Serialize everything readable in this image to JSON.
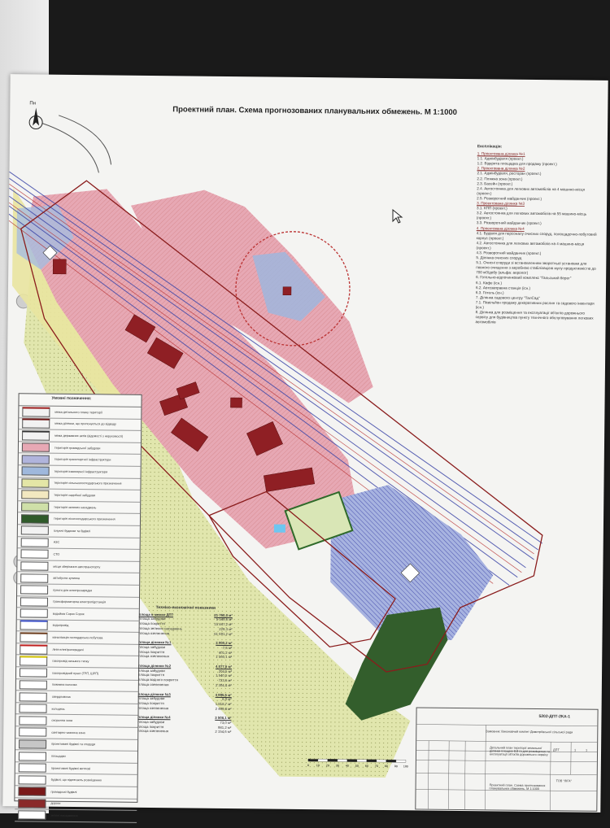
{
  "title": "Проектний план. Схема прогнозованих планувальних обмежень. М 1:1000",
  "north_label": "Пн",
  "explication": {
    "header": "Експлікація:",
    "items": [
      {
        "text": "1. Проектована ділянка №1",
        "section": true
      },
      {
        "text": "1.1. Адмінбудівля (проект.)"
      },
      {
        "text": "1.2. Відкрита площадка для продажу (проект.)"
      },
      {
        "text": "2. Проектована ділянка №2",
        "section": true
      },
      {
        "text": "2.1. Адмінбудівля, ресторан (проект.)"
      },
      {
        "text": "2.2. Пляжна зона (проект.)"
      },
      {
        "text": "2.3. Басейн (проект.)"
      },
      {
        "text": "2.4. Автостоянка для легкових автомобілів на 4 машино-місця (проект.)"
      },
      {
        "text": "2.5. Розворотний майданчик (проект.)"
      },
      {
        "text": "3. Проектована ділянка №3",
        "section": true
      },
      {
        "text": "3.1. КПП (проект.)"
      },
      {
        "text": "3.2. Автостоянка для легкових автомобілів на 55 машино-місць (проект.)"
      },
      {
        "text": "3.3. Розворотний майданчик (проект.)"
      },
      {
        "text": "4. Проектована ділянка №4",
        "section": true
      },
      {
        "text": "4.1. Будівля для персоналу очисних споруд, полощадочно-побутовий корпус (проект.)"
      },
      {
        "text": "4.2. Автостоянка для легкових автомобілів на 4 машино-місця (проект.)"
      },
      {
        "text": "4.3. Розворотний майданчик (проект.)"
      },
      {
        "text": "5. Ділянка очисних споруд"
      },
      {
        "text": "5.1. Очисні споруди зі встановленням зворотньої установки для повного очищення з аеробною стабілізацією мулу продуктивністю до 700 м3/добу (альфа: аеропот)"
      },
      {
        "text": "6. Готельно-відпочинковий комплекс \"Гальський берег\""
      },
      {
        "text": "6.1. Кафе (існ.)"
      },
      {
        "text": "6.2. Автозаправна станція (існ.)"
      },
      {
        "text": "6.3. Готель (існ.)"
      },
      {
        "text": "7. Ділянка садового центру \"ТалСад\""
      },
      {
        "text": "7.1. Павільйон продажу декоративних рослин та садового інвентаря (існ.)"
      },
      {
        "text": "8. Ділянка для розміщення та експлуатації об'єктів дорожнього сервісу для будівництва пункту технічного обслуговування легкових автомобілів"
      }
    ]
  },
  "legend": {
    "header": "Умовні позначення:",
    "rows": [
      {
        "label": "межа детального плану території",
        "swatch": "#f2f2f2",
        "line": "#9b1c1c"
      },
      {
        "label": "межа ділянки, що пропонується до відводу",
        "swatch": "#f2f2f2",
        "line": "#6b1414"
      },
      {
        "label": "межа державних актів (відомості з нерухомості)",
        "swatch": "#f2f2f2",
        "line": "#333333"
      },
      {
        "label": "територія громадської забудови",
        "swatch": "#e7a8b4"
      },
      {
        "label": "територія транспортної інфраструктури",
        "swatch": "#b0b4dc"
      },
      {
        "label": "територія інженерної інфраструктури",
        "swatch": "#9fb8dc"
      },
      {
        "label": "територія сільськогосподарського призначення",
        "swatch": "#e4e6a6"
      },
      {
        "label": "територія садибної забудови",
        "swatch": "#f2e8c0"
      },
      {
        "label": "територія зелених насаджень",
        "swatch": "#cfe0a8"
      },
      {
        "label": "територія лісогосподарського призначення",
        "swatch": "#2f5a2a"
      },
      {
        "label": "існуючі будинки та будівлі",
        "swatch": "#f2f2f2"
      },
      {
        "label": "АЗС",
        "swatch": "#ffffff"
      },
      {
        "label": "СТО",
        "swatch": "#ffffff"
      },
      {
        "label": "місця зберігання автотранспорту",
        "swatch": "#ffffff"
      },
      {
        "label": "автобусна зупинка",
        "swatch": "#ffffff"
      },
      {
        "label": "пункти для електрозарядки",
        "swatch": "#ffffff"
      },
      {
        "label": "трансформаторна електропідстанція",
        "swatch": "#ffffff"
      },
      {
        "label": "водойма Сорок Сорок",
        "swatch": "#ffffff"
      },
      {
        "label": "водопровід",
        "swatch": "#ffffff",
        "line": "#3a4ec8"
      },
      {
        "label": "каналізація господарсько-побутова",
        "swatch": "#ffffff",
        "line": "#6a3a1a"
      },
      {
        "label": "лінія електропередачі",
        "swatch": "#ffffff",
        "line": "#c02020"
      },
      {
        "label": "газопровід низького тиску",
        "swatch": "#ffffff",
        "line": "#d0c000"
      },
      {
        "label": "газопровідний пункт (ГРП, ШРП)",
        "swatch": "#ffffff"
      },
      {
        "label": "пожежна колонка",
        "swatch": "#ffffff"
      },
      {
        "label": "свердловина",
        "swatch": "#ffffff"
      },
      {
        "label": "колодязь",
        "swatch": "#ffffff"
      },
      {
        "label": "охоронна зона",
        "swatch": "#ffffff"
      },
      {
        "label": "санітарно-захисна зона",
        "swatch": "#ffffff"
      },
      {
        "label": "проектовані будівлі та споруди",
        "swatch": "#c6c6c6"
      },
      {
        "label": "площадки",
        "swatch": "#ffffff"
      },
      {
        "label": "проектовані будівлі житлові",
        "swatch": "#ffffff"
      },
      {
        "label": "будівлі, що підлягають розміщенню",
        "swatch": "#ffffff"
      },
      {
        "label": "громадські будівлі",
        "swatch": "#7a1a1a"
      },
      {
        "label": "дороги",
        "swatch": "#8a2a2a"
      },
      {
        "label": "зелені насадження",
        "swatch": "#ffffff"
      }
    ]
  },
  "tep": {
    "header": "Техніко-економічні показники",
    "groups": [
      {
        "title": "площа в межах ДПТ",
        "total": "21 760,3 м²",
        "rows": [
          [
            "площа забудови",
            "5 549,5 м²"
          ],
          [
            "площа покриття",
            "15 847,2 м²"
          ],
          [
            "площа зелених насаджень",
            "229,3 м²"
          ],
          [
            "площа озеленення",
            "61 691,2 м²"
          ]
        ]
      },
      {
        "title": "площа ділянки №1",
        "total": "2 000,2 м²",
        "rows": [
          [
            "площа забудови",
            "7,5 м²"
          ],
          [
            "площа покриття",
            "401,2 м²"
          ],
          [
            "площа озеленення",
            "1 560,1 м²"
          ]
        ]
      },
      {
        "title": "площа ділянки №2",
        "total": "4 877,5 м²",
        "rows": [
          [
            "площа забудови",
            "204,5 м²"
          ],
          [
            "площа покриття",
            "1 540,5 м²"
          ],
          [
            "площа водного покриття",
            "723,5 м²"
          ],
          [
            "площа озеленення",
            "2 304,4 м²"
          ]
        ]
      },
      {
        "title": "площа ділянки №3",
        "total": "4 995,5 м²",
        "rows": [
          [
            "площа забудови",
            "6,0 м²"
          ],
          [
            "площа покриття",
            "1 818,7 м²"
          ],
          [
            "площа озеленення",
            "2 409,8 м²"
          ]
        ]
      },
      {
        "title": "площа ділянки №4",
        "total": "3 508,1 м²",
        "rows": [
          [
            "площа забудови",
            "73,0 м²"
          ],
          [
            "площа покриття",
            "981,2 м²"
          ],
          [
            "площа озеленення",
            "2 154,6 м²"
          ]
        ]
      }
    ]
  },
  "scale_ticks": [
    "0",
    "10",
    "20",
    "30",
    "40",
    "50",
    "60",
    "70",
    "80",
    "90",
    "100"
  ],
  "stamp": {
    "code": "5202-ДПТ-2КА-1",
    "client": "Замовник: Виконавчий комітет Димитріївської сільської ради",
    "project": "Детальний план території земельної ділянки площею 8,8 га для розміщення та експлуатації об'єктів дорожнього сервісу",
    "sheet_title": "Проектний план. Схема прогнозованих планувальних обмежень. М 1:1000",
    "stage": "ДПТ",
    "sheet": "1",
    "sheets": "1",
    "org": "ТОВ \"ЛІГА\""
  },
  "colors": {
    "public": "#e7a8b4",
    "building": "#8f1f24",
    "transport": "#6c72c4",
    "green": "#dfe3a6",
    "forest": "#335e2c",
    "boundary": "#8a1c1c"
  }
}
